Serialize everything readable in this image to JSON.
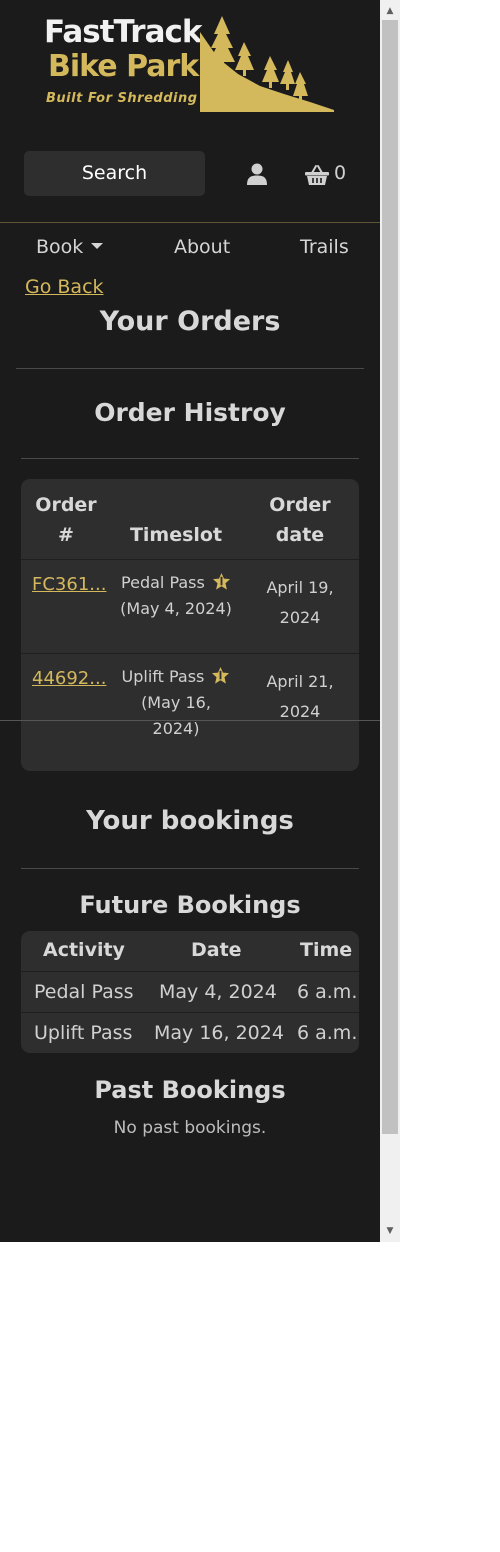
{
  "logo": {
    "line1": "FastTrack",
    "line2": "Bike Park",
    "tagline": "Built For Shredding"
  },
  "header": {
    "search_label": "Search",
    "cart_count": "0",
    "icons": [
      "user-icon",
      "basket-icon"
    ]
  },
  "nav": {
    "items": [
      {
        "label": "Book",
        "has_dropdown": true
      },
      {
        "label": "About"
      },
      {
        "label": "Trails"
      }
    ]
  },
  "go_back": "Go Back",
  "orders": {
    "title": "Your Orders",
    "history_title": "Order Histroy",
    "columns": [
      "Order",
      "#",
      "Timeslot",
      "Order",
      "date"
    ],
    "rows": [
      {
        "order_no": "FC361...",
        "pass": "Pedal Pass",
        "slot": "(May 4, 2024)",
        "date_line1": "April 19,",
        "date_line2": "2024"
      },
      {
        "order_no": "44692...",
        "pass": "Uplift Pass",
        "slot_line1": "(May 16,",
        "slot_line2": "2024)",
        "date_line1": "April 21,",
        "date_line2": "2024"
      }
    ]
  },
  "bookings": {
    "title": "Your bookings",
    "future_title": "Future Bookings",
    "columns": [
      "Activity",
      "Date",
      "Time"
    ],
    "rows": [
      {
        "activity": "Pedal Pass",
        "date": "May 4, 2024",
        "time": "6 a.m."
      },
      {
        "activity": "Uplift Pass",
        "date": "May 16, 2024",
        "time": "6 a.m."
      }
    ],
    "past_title": "Past Bookings",
    "past_empty": "No past bookings."
  },
  "colors": {
    "background": "#1b1b1b",
    "surface": "#2e2e2e",
    "accent": "#d4b85c",
    "text": "#d8d8d8"
  }
}
